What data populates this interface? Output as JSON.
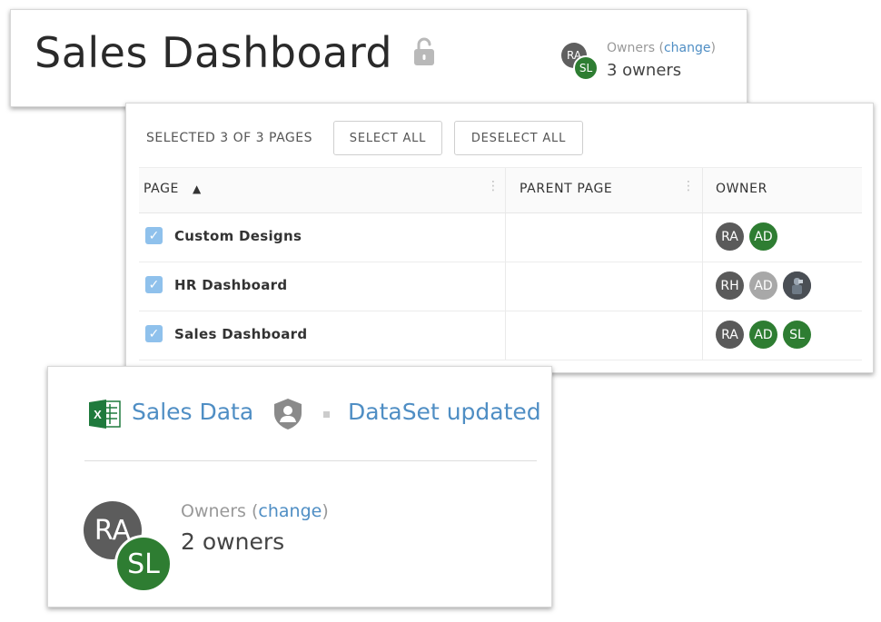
{
  "dashboard": {
    "title": "Sales Dashboard",
    "owners_label": "Owners",
    "change_label": "change",
    "owners_count_text": "3 owners",
    "owner_avatars": [
      "RA",
      "SL"
    ],
    "lock_icon": "unlocked-padlock-icon"
  },
  "pages_panel": {
    "selection_text": "SELECTED 3 OF 3 PAGES",
    "select_all_label": "SELECT ALL",
    "deselect_all_label": "DESELECT ALL",
    "columns": {
      "page": "PAGE",
      "sort_indicator": "▲",
      "parent_page": "PARENT PAGE",
      "owner": "OWNER"
    },
    "rows": [
      {
        "name": "Custom Designs",
        "checked": true,
        "parent": "",
        "owners": [
          "RA",
          "AD"
        ]
      },
      {
        "name": "HR Dashboard",
        "checked": true,
        "parent": "",
        "owners": [
          "RH",
          "AD",
          "photo"
        ]
      },
      {
        "name": "Sales Dashboard",
        "checked": true,
        "parent": "",
        "owners": [
          "RA",
          "AD",
          "SL"
        ]
      }
    ]
  },
  "dataset": {
    "name": "Sales Data",
    "status": "DataSet updated",
    "owners_label": "Owners",
    "change_label": "change",
    "owners_count_text": "2 owners",
    "owner_avatars": [
      "RA",
      "SL"
    ]
  },
  "colors": {
    "link": "#4f8ec4",
    "green_avatar": "#2e7d32",
    "dark_avatar": "#5a5a5a",
    "checkbox": "#8fc1ec"
  }
}
